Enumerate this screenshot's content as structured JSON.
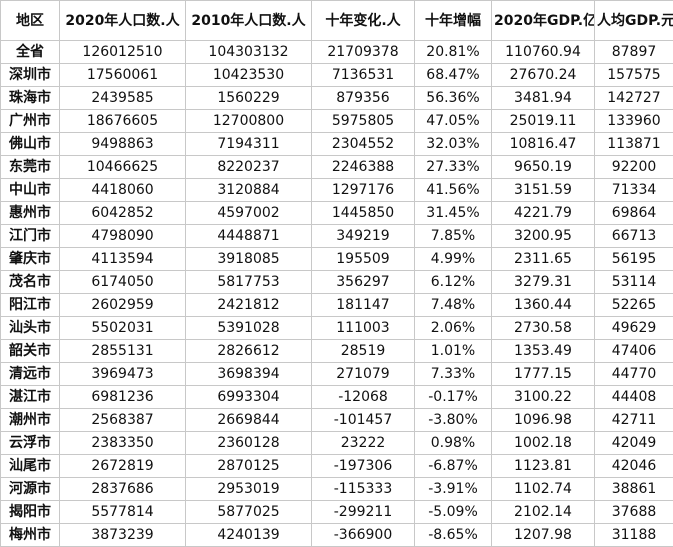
{
  "table": {
    "headers": [
      "地区",
      "2020年人口数.人",
      "2010年人口数.人",
      "十年变化.人",
      "十年增幅",
      "2020年GDP.亿",
      "人均GDP.元"
    ],
    "rows": [
      [
        "全省",
        "126012510",
        "104303132",
        "21709378",
        "20.81%",
        "110760.94",
        "87897"
      ],
      [
        "深圳市",
        "17560061",
        "10423530",
        "7136531",
        "68.47%",
        "27670.24",
        "157575"
      ],
      [
        "珠海市",
        "2439585",
        "1560229",
        "879356",
        "56.36%",
        "3481.94",
        "142727"
      ],
      [
        "广州市",
        "18676605",
        "12700800",
        "5975805",
        "47.05%",
        "25019.11",
        "133960"
      ],
      [
        "佛山市",
        "9498863",
        "7194311",
        "2304552",
        "32.03%",
        "10816.47",
        "113871"
      ],
      [
        "东莞市",
        "10466625",
        "8220237",
        "2246388",
        "27.33%",
        "9650.19",
        "92200"
      ],
      [
        "中山市",
        "4418060",
        "3120884",
        "1297176",
        "41.56%",
        "3151.59",
        "71334"
      ],
      [
        "惠州市",
        "6042852",
        "4597002",
        "1445850",
        "31.45%",
        "4221.79",
        "69864"
      ],
      [
        "江门市",
        "4798090",
        "4448871",
        "349219",
        "7.85%",
        "3200.95",
        "66713"
      ],
      [
        "肇庆市",
        "4113594",
        "3918085",
        "195509",
        "4.99%",
        "2311.65",
        "56195"
      ],
      [
        "茂名市",
        "6174050",
        "5817753",
        "356297",
        "6.12%",
        "3279.31",
        "53114"
      ],
      [
        "阳江市",
        "2602959",
        "2421812",
        "181147",
        "7.48%",
        "1360.44",
        "52265"
      ],
      [
        "汕头市",
        "5502031",
        "5391028",
        "111003",
        "2.06%",
        "2730.58",
        "49629"
      ],
      [
        "韶关市",
        "2855131",
        "2826612",
        "28519",
        "1.01%",
        "1353.49",
        "47406"
      ],
      [
        "清远市",
        "3969473",
        "3698394",
        "271079",
        "7.33%",
        "1777.15",
        "44770"
      ],
      [
        "湛江市",
        "6981236",
        "6993304",
        "-12068",
        "-0.17%",
        "3100.22",
        "44408"
      ],
      [
        "潮州市",
        "2568387",
        "2669844",
        "-101457",
        "-3.80%",
        "1096.98",
        "42711"
      ],
      [
        "云浮市",
        "2383350",
        "2360128",
        "23222",
        "0.98%",
        "1002.18",
        "42049"
      ],
      [
        "汕尾市",
        "2672819",
        "2870125",
        "-197306",
        "-6.87%",
        "1123.81",
        "42046"
      ],
      [
        "河源市",
        "2837686",
        "2953019",
        "-115333",
        "-3.91%",
        "1102.74",
        "38861"
      ],
      [
        "揭阳市",
        "5577814",
        "5877025",
        "-299211",
        "-5.09%",
        "2102.14",
        "37688"
      ],
      [
        "梅州市",
        "3873239",
        "4240139",
        "-366900",
        "-8.65%",
        "1207.98",
        "31188"
      ]
    ]
  }
}
